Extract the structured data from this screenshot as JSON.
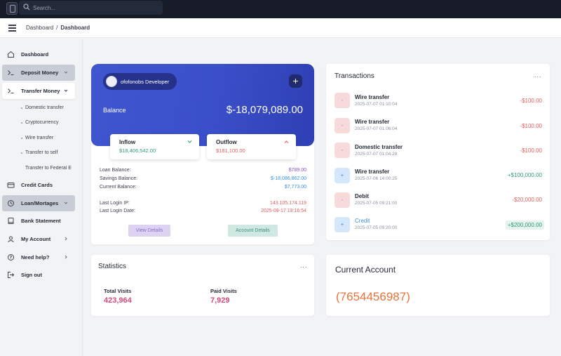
{
  "search": {
    "placeholder": "Search..."
  },
  "breadcrumb": {
    "root": "Dashboard",
    "separator": "/",
    "current": "Dashboard"
  },
  "sidebar": {
    "items": [
      {
        "label": "Dashboard",
        "icon": "home-icon"
      },
      {
        "label": "Deposit Money",
        "icon": "terminal-icon",
        "expandable": true
      },
      {
        "label": "Transfer Money",
        "icon": "terminal-icon",
        "expandable": true,
        "expanded": true
      },
      {
        "label": "Credit Cards",
        "icon": "credit-card-icon"
      },
      {
        "label": "Loan/Mortages",
        "icon": "clock-icon",
        "expandable": true
      },
      {
        "label": "Bank Statement",
        "icon": "book-icon"
      },
      {
        "label": "My Account",
        "icon": "user-icon",
        "expandable": true
      },
      {
        "label": "Need help?",
        "icon": "help-icon",
        "expandable": true
      },
      {
        "label": "Sign out",
        "icon": "sign-out-icon"
      }
    ],
    "transfer_subitems": [
      "Domestic transfer",
      "Cryptocurrency",
      "Wire transfer",
      "Transfer to self",
      "Transfer to Federal E"
    ]
  },
  "balance_card": {
    "account_name": "ofofonobs Developer",
    "balance_label": "Balance",
    "balance_value": "$-18,079,089.00",
    "plus": "+"
  },
  "inflow": {
    "label": "Inflow",
    "value": "$18,406,542.00"
  },
  "outflow": {
    "label": "Outflow",
    "value": "$181,100.00"
  },
  "details": {
    "loan_balance": {
      "label": "Loan Balance:",
      "value": "$789.00"
    },
    "savings_balance": {
      "label": "Savings Balance:",
      "value": "$-18,086,862.00"
    },
    "current_balance": {
      "label": "Current Balance:",
      "value": "$7,773.00"
    },
    "last_login_ip": {
      "label": "Last Login IP:",
      "value": "143.105.174.119"
    },
    "last_login_date": {
      "label": "Last Login Date:",
      "value": "2025-09-17 19:16:54"
    }
  },
  "buttons": {
    "view_details": "View Details",
    "account_details": "Account Details"
  },
  "transactions": {
    "title": "Transactions",
    "menu": "...",
    "items": [
      {
        "name": "Wire transfer",
        "date": "2025-07-07 01:10:04",
        "amount": "-$100.00",
        "type": "out",
        "symbol": "-"
      },
      {
        "name": "Wire transfer",
        "date": "2025-07-07 01:06:04",
        "amount": "-$100.00",
        "type": "out",
        "symbol": "-"
      },
      {
        "name": "Domestic transfer",
        "date": "2025-07-07 01:04:28",
        "amount": "-$100.00",
        "type": "out",
        "symbol": "-"
      },
      {
        "name": "Wire transfer",
        "date": "2025-07-06 14:00:25",
        "amount": "+$100,000.00",
        "type": "in",
        "symbol": "+"
      },
      {
        "name": "Debit",
        "date": "2025-07-05 09:21:00",
        "amount": "-$20,000.00",
        "type": "out",
        "symbol": "-"
      },
      {
        "name": "Credit",
        "date": "2025-07-05 09:20:00",
        "amount": "+$200,000.00",
        "type": "in",
        "symbol": "+"
      }
    ]
  },
  "statistics": {
    "title": "Statistics",
    "menu": "...",
    "total_visits_label": "Total Visits",
    "total_visits_value": "423,964",
    "paid_visits_label": "Paid Visits",
    "paid_visits_value": "7,929"
  },
  "current_account": {
    "title": "Current Account",
    "number": "(7654456987)"
  },
  "colors": {
    "accent": "#3f56cf",
    "positive": "#2f9a7c",
    "negative": "#e25d5d",
    "stat": "#d94b78",
    "account_number": "#e8743b"
  }
}
